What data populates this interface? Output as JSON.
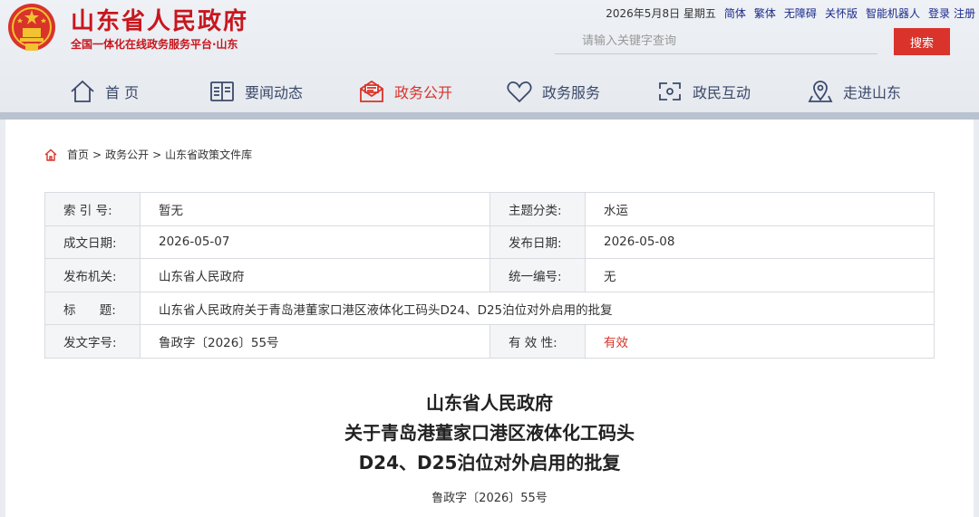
{
  "header": {
    "site_title": "山东省人民政府",
    "site_subtitle": "全国一体化在线政务服务平台·山东",
    "date": "2026年5月8日 星期五",
    "links": [
      "简体",
      "繁体",
      "无障碍",
      "关怀版",
      "智能机器人"
    ],
    "login": "登录",
    "register": "注册",
    "search_placeholder": "请输入关键字查询",
    "search_button": "搜索",
    "accent_color": "#d9332b"
  },
  "nav": [
    {
      "label": "首 页",
      "icon": "home-icon"
    },
    {
      "label": "要闻动态",
      "icon": "news-icon"
    },
    {
      "label": "政务公开",
      "icon": "mail-icon",
      "active": true
    },
    {
      "label": "政务服务",
      "icon": "heart-icon"
    },
    {
      "label": "政民互动",
      "icon": "interaction-icon"
    },
    {
      "label": "走进山东",
      "icon": "location-icon"
    }
  ],
  "breadcrumb": [
    "首页",
    "政务公开",
    "山东省政策文件库"
  ],
  "meta": {
    "index_label": "索 引 号:",
    "index_value": "暂无",
    "topic_label": "主题分类:",
    "topic_value": "水运",
    "created_label": "成文日期:",
    "created_value": "2026-05-07",
    "published_label": "发布日期:",
    "published_value": "2026-05-08",
    "org_label": "发布机关:",
    "org_value": "山东省人民政府",
    "code_label": "统一编号:",
    "code_value": "无",
    "title_label": "标 题:",
    "title_value": "山东省人民政府关于青岛港董家口港区液体化工码头D24、D25泊位对外启用的批复",
    "docno_label": "发文字号:",
    "docno_value": "鲁政字〔2026〕55号",
    "validity_label": "有 效 性:",
    "validity_value": "有效"
  },
  "document": {
    "title_line1": "山东省人民政府",
    "title_line2": "关于青岛港董家口港区液体化工码头",
    "title_line3": "D24、D25泊位对外启用的批复",
    "number": "鲁政字〔2026〕55号"
  }
}
